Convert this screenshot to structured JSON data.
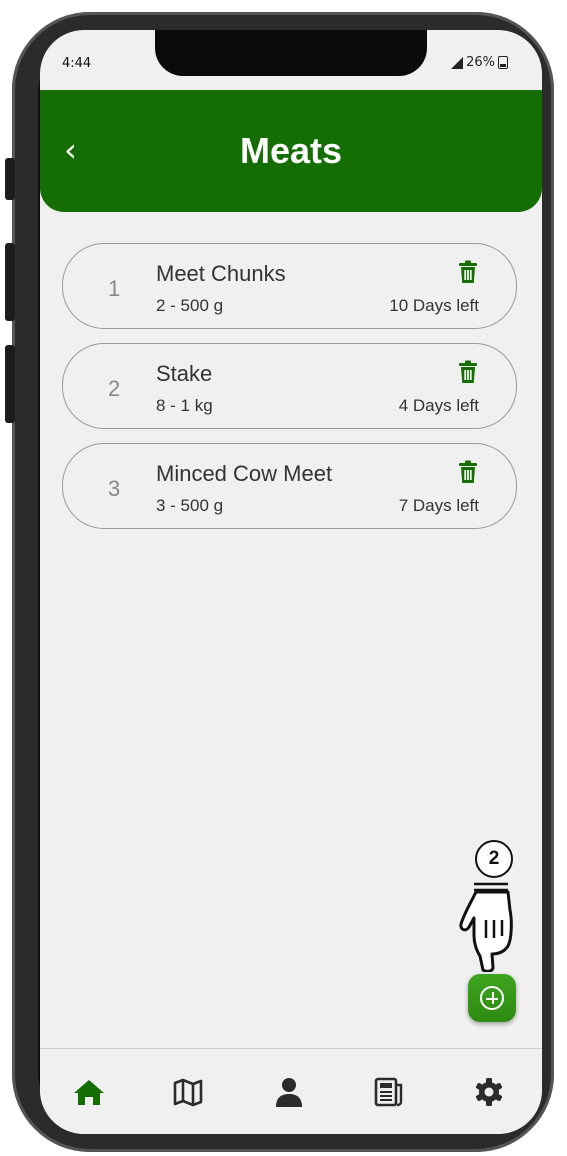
{
  "status_bar": {
    "time": "4:44",
    "battery": "26%"
  },
  "header": {
    "title": "Meats",
    "back_icon": "chevron-left-icon"
  },
  "items": [
    {
      "index": "1",
      "name": "Meet Chunks",
      "quantity": "2 - 500 g",
      "days_left": "10 Days left"
    },
    {
      "index": "2",
      "name": "Stake",
      "quantity": "8 - 1 kg",
      "days_left": "4 Days left"
    },
    {
      "index": "3",
      "name": "Minced Cow Meet",
      "quantity": "3 - 500 g",
      "days_left": "7 Days left"
    }
  ],
  "annotation": {
    "step": "2"
  },
  "fab": {
    "icon": "plus-circle-icon"
  },
  "bottom_nav": [
    {
      "icon": "home-icon",
      "active": true
    },
    {
      "icon": "map-icon",
      "active": false
    },
    {
      "icon": "user-icon",
      "active": false
    },
    {
      "icon": "news-icon",
      "active": false
    },
    {
      "icon": "gear-icon",
      "active": false
    }
  ],
  "colors": {
    "primary": "#156e04",
    "fab": "#3fa41f",
    "background": "#f0f0f0",
    "active_nav": "#156e04",
    "inactive_nav": "#2b2b2b"
  }
}
